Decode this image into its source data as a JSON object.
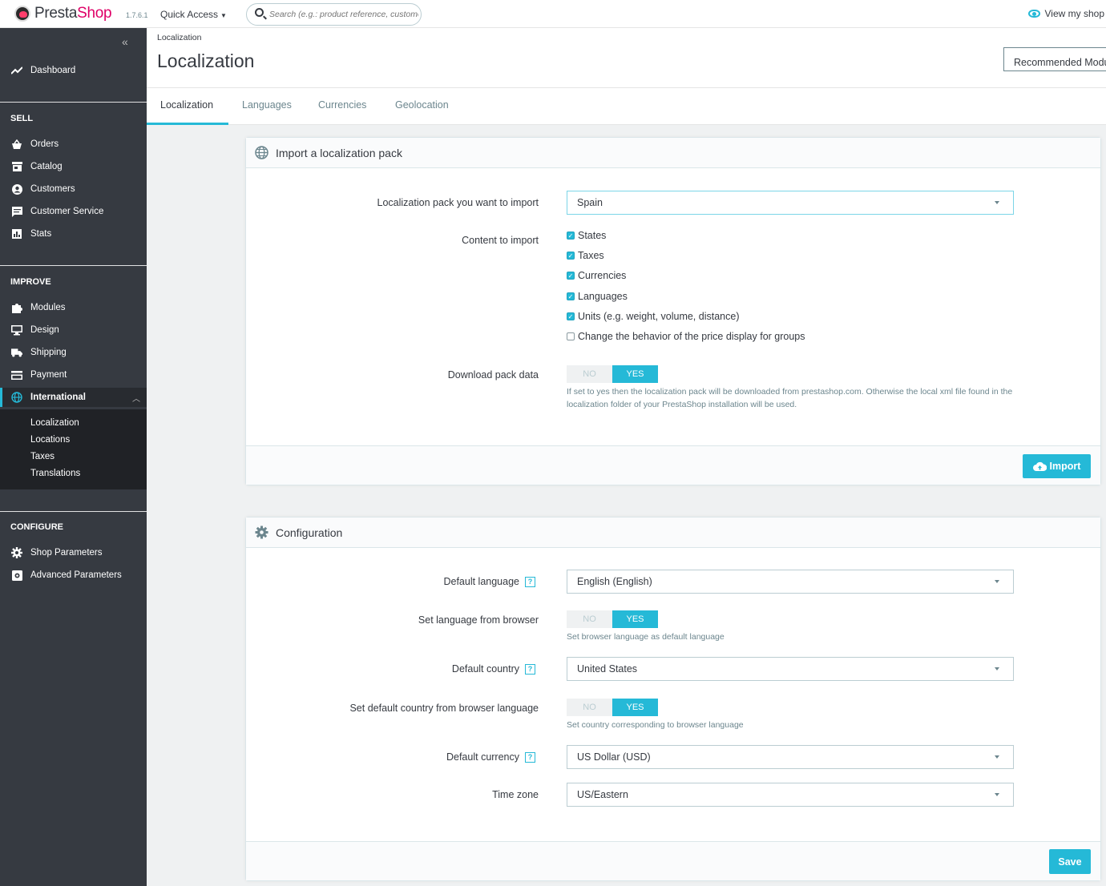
{
  "header": {
    "brand_dark": "Presta",
    "brand_accent": "Shop",
    "version": "1.7.6.1",
    "quick_access": "Quick Access",
    "search_placeholder": "Search (e.g.: product reference, customer name…)",
    "view_shop": "View my shop"
  },
  "sidebar": {
    "dashboard": "Dashboard",
    "sections": {
      "sell": "SELL",
      "improve": "IMPROVE",
      "configure": "CONFIGURE"
    },
    "sell_items": [
      "Orders",
      "Catalog",
      "Customers",
      "Customer Service",
      "Stats"
    ],
    "improve_items": [
      "Modules",
      "Design",
      "Shipping",
      "Payment",
      "International"
    ],
    "international_sub": [
      "Localization",
      "Locations",
      "Taxes",
      "Translations"
    ],
    "configure_items": [
      "Shop Parameters",
      "Advanced Parameters"
    ]
  },
  "page": {
    "breadcrumb": "Localization",
    "title": "Localization",
    "recommended_button": "Recommended Modules"
  },
  "tabs": [
    "Localization",
    "Languages",
    "Currencies",
    "Geolocation"
  ],
  "import_panel": {
    "title": "Import a localization pack",
    "pack_label": "Localization pack you want to import",
    "pack_value": "Spain",
    "content_label": "Content to import",
    "content_options": [
      {
        "label": "States",
        "checked": true
      },
      {
        "label": "Taxes",
        "checked": true
      },
      {
        "label": "Currencies",
        "checked": true
      },
      {
        "label": "Languages",
        "checked": true
      },
      {
        "label": "Units (e.g. weight, volume, distance)",
        "checked": true
      },
      {
        "label": "Change the behavior of the price display for groups",
        "checked": false
      }
    ],
    "download_label": "Download pack data",
    "switch_no": "NO",
    "switch_yes": "YES",
    "download_hint": "If set to yes then the localization pack will be downloaded from prestashop.com. Otherwise the local xml file found in the localization folder of your PrestaShop installation will be used.",
    "import_button": "Import"
  },
  "config_panel": {
    "title": "Configuration",
    "help_glyph": "?",
    "default_language_label": "Default language",
    "default_language_value": "English (English)",
    "lang_browser_label": "Set language from browser",
    "lang_browser_hint": "Set browser language as default language",
    "default_country_label": "Default country",
    "default_country_value": "United States",
    "country_browser_label": "Set default country from browser language",
    "country_browser_hint": "Set country corresponding to browser language",
    "default_currency_label": "Default currency",
    "default_currency_value": "US Dollar (USD)",
    "timezone_label": "Time zone",
    "timezone_value": "US/Eastern",
    "save_button": "Save"
  },
  "colors": {
    "accent": "#25b9d7",
    "sidebar": "#363a41",
    "brand_pink": "#df0067"
  }
}
